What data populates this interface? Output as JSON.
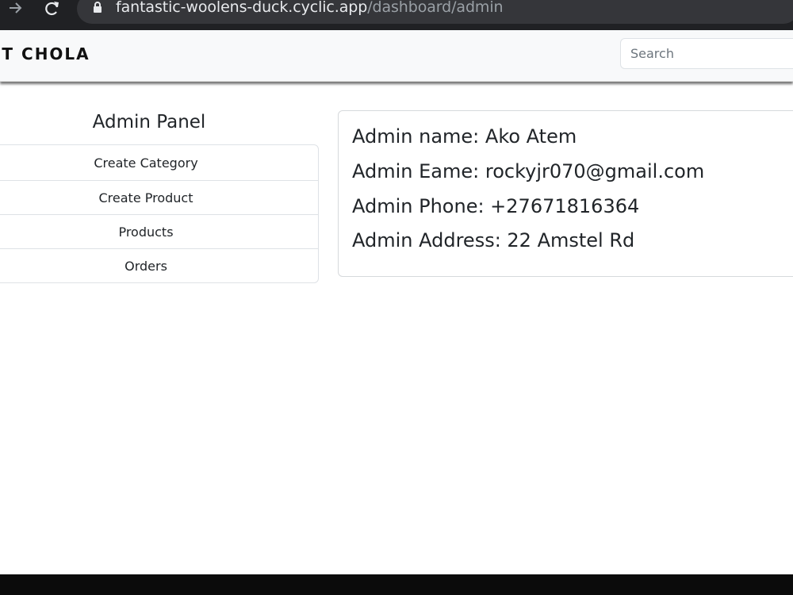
{
  "browser": {
    "url_host": "fantastic-woolens-duck.cyclic.app",
    "url_path": "/dashboard/admin",
    "icons": [
      "forward-icon",
      "reload-icon",
      "lock-icon"
    ]
  },
  "navbar": {
    "brand": "ST CHOLA",
    "search_placeholder": "Search"
  },
  "sidebar": {
    "title": "Admin Panel",
    "items": [
      {
        "label": "Create Category"
      },
      {
        "label": "Create Product"
      },
      {
        "label": "Products"
      },
      {
        "label": "Orders"
      }
    ]
  },
  "admin_info": {
    "name": "Admin name: Ako Atem",
    "email": "Admin Eame: rockyjr070@gmail.com",
    "phone": "Admin Phone: +27671816364",
    "address": "Admin Address: 22 Amstel Rd"
  },
  "colors": {
    "browser_chrome": "#202124",
    "omnibox": "#35363a",
    "navbar_bg": "#f8f9fa",
    "border": "#dee2e6",
    "text": "#212529"
  }
}
